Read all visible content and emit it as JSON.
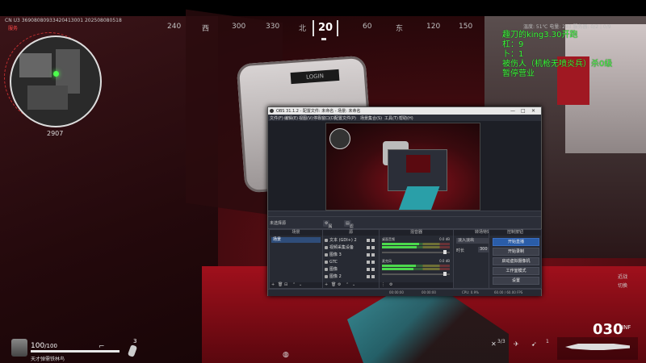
{
  "hud": {
    "top_info_line1": "CN U3 36908080933420413001 202508080518",
    "top_info_line2": "服务",
    "top_right_info": "温度: 51℃  电量: 293  服务器: 0/2 | 0/9",
    "compass": {
      "ticks": [
        "240",
        "西",
        "300",
        "330",
        "北",
        "20",
        "60",
        "东",
        "120",
        "150"
      ],
      "heading": "20"
    },
    "minimap_heading": "2907",
    "overlay_lines": [
      "趣刀的king3.30开跑",
      "杠：9",
      "卜：1",
      "被伤人（机枪无喷炎兵）杀0级",
      "暂停营业"
    ],
    "health_value": "100",
    "health_max": "/100",
    "health_fraction": 1.0,
    "player_name": "天才弹需铁林鸟",
    "grenade_count": "3",
    "ammo_clip": "030",
    "ammo_reserve": "INF",
    "killstreak_a": "3/3",
    "killstreak_b": "1",
    "side_labels": [
      "近战",
      "切换"
    ],
    "bottom_center": "0"
  },
  "obs": {
    "title": "OBS 31.1.2 - 配置文件: 未命名 - 场景: 未命名",
    "menu": [
      "文件(F)",
      "编辑(E)",
      "视图(V)",
      "停靠窗口(D)",
      "配置文件(P)",
      "场景集合(S)",
      "工具(T)",
      "帮助(H)"
    ],
    "ctrl_bar": [
      "未选择源",
      "属性",
      "滤镜"
    ],
    "source_bar_label": "未选择源",
    "docks": {
      "scenes": "场景",
      "sources": "源",
      "mixer": "混音器",
      "transitions": "转场特效",
      "controls": "控制按钮"
    },
    "scene_item": "场景",
    "sources": [
      {
        "label": "文本 (GDI+) 2"
      },
      {
        "label": "视频采集设备"
      },
      {
        "label": "图像 3"
      },
      {
        "label": "GTC"
      },
      {
        "label": "图像"
      },
      {
        "label": "图像 2"
      }
    ],
    "mixer": [
      {
        "name": "桌面音频",
        "db": "0.0 dB",
        "level": 0.55,
        "volume": 0.95
      },
      {
        "name": "麦克风",
        "db": "0.0 dB",
        "level": 0.5,
        "volume": 0.95
      }
    ],
    "transition": {
      "selected": "淡入淡出",
      "duration_label": "时长",
      "duration_value": "300 ms"
    },
    "controls": [
      "开始直播",
      "开始录制",
      "启动虚拟摄像机",
      "工作室模式",
      "设置"
    ],
    "status": [
      "00:00:00",
      "00:00:00",
      "CPU: 0.9%",
      "60.00 / 60.00 FPS"
    ]
  }
}
